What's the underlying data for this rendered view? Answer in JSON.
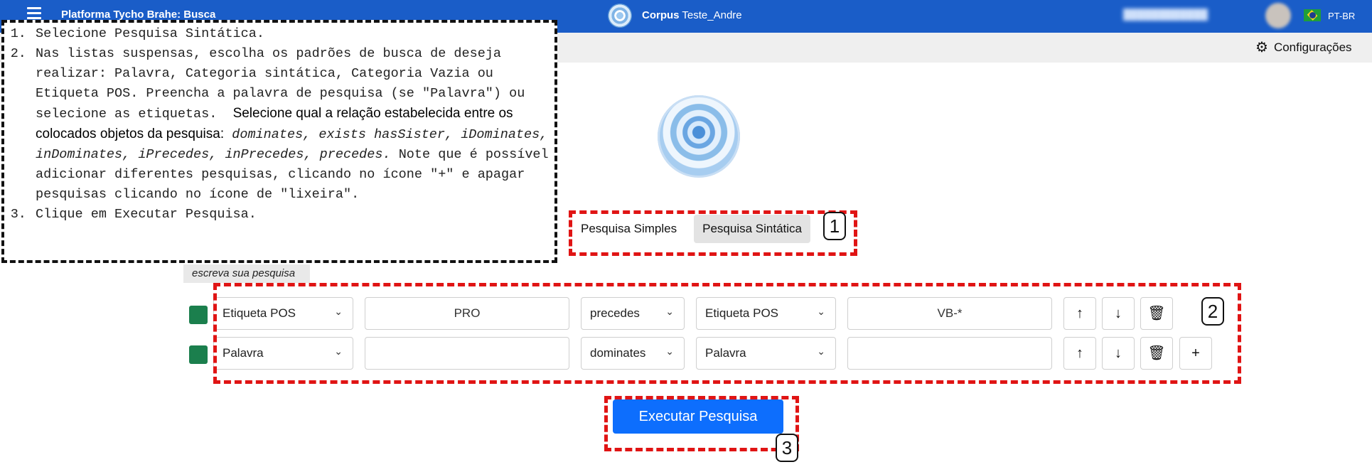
{
  "topbar": {
    "app_title": "Platforma Tycho Brahe: Busca",
    "corpus_prefix": "Corpus",
    "corpus_name": "Teste_Andre",
    "language": "PT-BR"
  },
  "settings": {
    "label": "Configurações"
  },
  "tabs": [
    {
      "label": "Pesquisa Simples",
      "active": false
    },
    {
      "label": "Pesquisa Sintática",
      "active": true
    }
  ],
  "query_label": "escreva sua pesquisa",
  "rows": [
    {
      "type1": "Etiqueta POS",
      "value1": "PRO",
      "relation": "precedes",
      "type2": "Etiqueta POS",
      "value2": "VB-*",
      "swatch_color": "#1b7f4d"
    },
    {
      "type1": "Palavra",
      "value1": "",
      "relation": "dominates",
      "type2": "Palavra",
      "value2": "",
      "swatch_color": "#1b7f4d"
    }
  ],
  "execute_label": "Executar Pesquisa",
  "callouts": [
    "1",
    "2",
    "3"
  ],
  "instructions": {
    "step1": "Selecione Pesquisa Sintática.",
    "step2_a": "Nas listas suspensas, escolha os padrões de busca de deseja realizar: Palavra, Categoria sintática, Categoria Vazia ou Etiqueta POS. Preencha a palavra de pesquisa (se \"Palavra\") ou selecione as etiquetas.",
    "step2_b": "Selecione qual a relação estabelecida entre os colocados objetos da pesquisa:",
    "step2_c": "dominates, exists hasSister, iDominates, inDominates, iPrecedes, inPrecedes, precedes.",
    "step2_d": "Note que é possível adicionar diferentes pesquisas, clicando no ícone \"+\" e apagar pesquisas clicando no ícone de \"lixeira\".",
    "step3": "Clique em Executar Pesquisa."
  },
  "colors": {
    "topbar": "#1a5dc8",
    "accent": "#0d6efd",
    "callout": "#e01414",
    "swatch": "#1b7f4d"
  }
}
